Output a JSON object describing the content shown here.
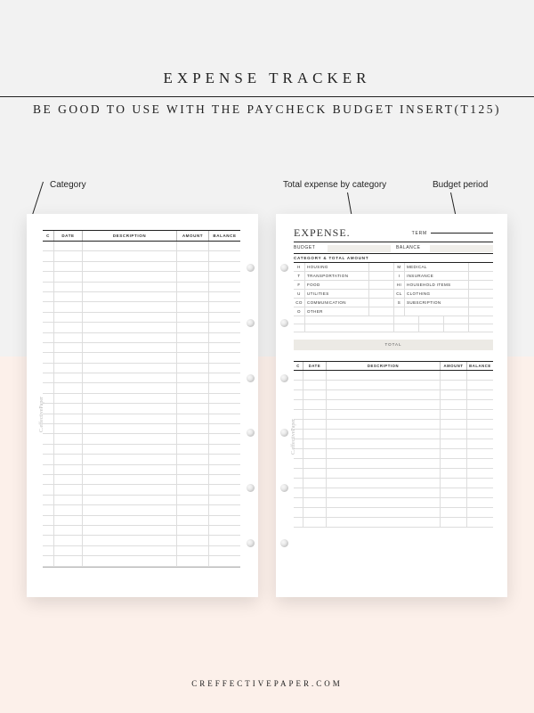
{
  "header": {
    "title": "EXPENSE TRACKER",
    "subtitle": "BE GOOD TO USE WITH THE PAYCHECK BUDGET INSERT(T125)"
  },
  "callouts": {
    "category": "Category",
    "total_by_category": "Total expense by category",
    "budget_period": "Budget period"
  },
  "left_page": {
    "columns": [
      "C",
      "DATE",
      "DESCRIPTION",
      "AMOUNT",
      "BALANCE"
    ],
    "row_count": 32,
    "watermark": "C.effectivePaper"
  },
  "right_page": {
    "heading": "EXPENSE.",
    "term_label": "TERM",
    "budget_label": "BUDGET",
    "balance_label": "BALANCE",
    "category_section_title": "CATEGORY & TOTAL AMOUNT",
    "categories_left": [
      {
        "code": "H",
        "name": "HOUSING"
      },
      {
        "code": "T",
        "name": "TRANSPORTATION"
      },
      {
        "code": "F",
        "name": "FOOD"
      },
      {
        "code": "U",
        "name": "UTILITIES"
      },
      {
        "code": "CO",
        "name": "COMMUNICATION"
      },
      {
        "code": "O",
        "name": "OTHER"
      }
    ],
    "categories_right": [
      {
        "code": "M",
        "name": "MEDICAL"
      },
      {
        "code": "I",
        "name": "INSURANCE"
      },
      {
        "code": "HI",
        "name": "HOUSEHOLD ITEMS"
      },
      {
        "code": "CL",
        "name": "CLOTHING"
      },
      {
        "code": "S",
        "name": "SUBSCRIPTION"
      },
      {
        "code": "",
        "name": ""
      }
    ],
    "extra_category_rows": 2,
    "total_label": "TOTAL",
    "ledger_columns": [
      "C",
      "DATE",
      "DESCRIPTION",
      "AMOUNT",
      "BALANCE"
    ],
    "ledger_row_count": 16,
    "watermark": "C.effectivePaper"
  },
  "footer": "CREFFECTIVEPAPER.COM"
}
